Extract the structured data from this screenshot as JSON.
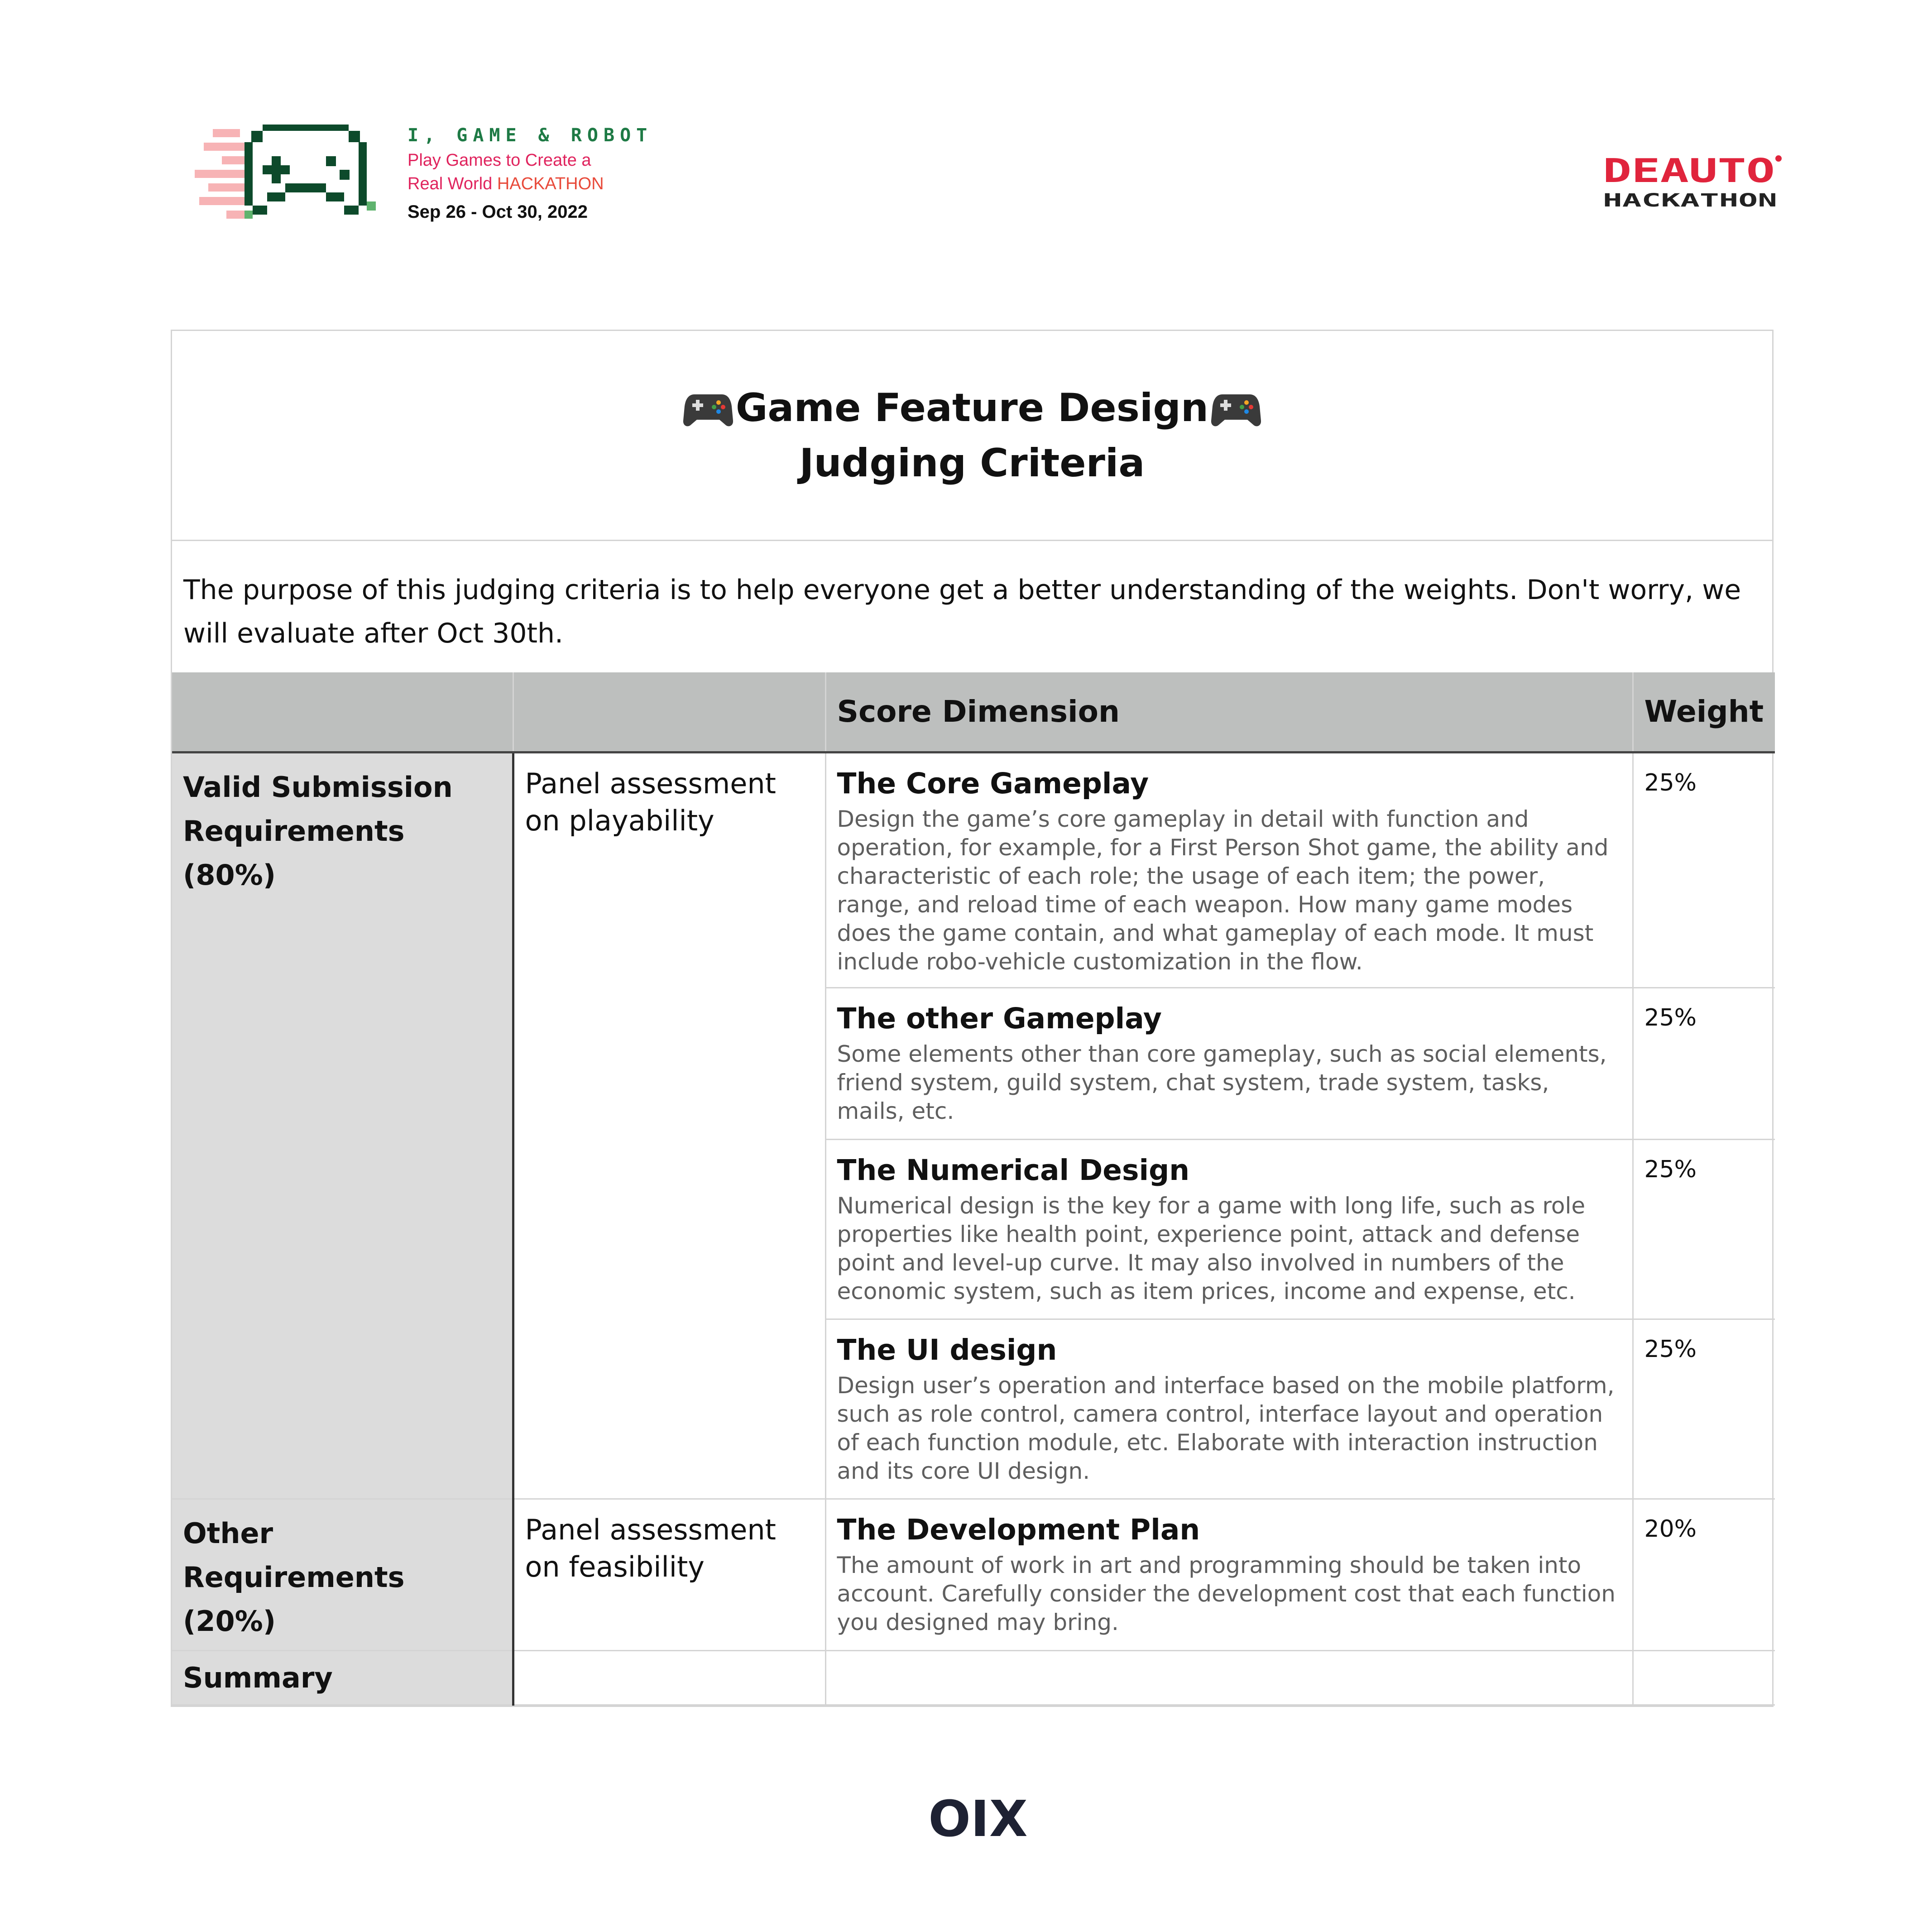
{
  "header": {
    "event_name": "I, GAME & ROBOT",
    "tagline_line1": "Play Games to Create a",
    "tagline_line2_prefix": "Real World ",
    "tagline_line2_highlight": "HACKATHON",
    "dates": "Sep 26 - Oct 30, 2022",
    "partner_logo_line1": "DEAUTO",
    "partner_logo_line2": "HACKATHON",
    "colors": {
      "event_green": "#1e7a45",
      "tagline_pink": "#e0245e",
      "partner_red": "#e0243c"
    }
  },
  "document": {
    "title_line1": "Game Feature Design",
    "title_line2": "Judging Criteria",
    "intro": "The purpose of this judging criteria is to help everyone get a better understanding of the weights. Don't worry, we will evaluate after Oct 30th."
  },
  "table": {
    "headers": [
      "",
      "",
      "Score Dimension",
      "Weight"
    ],
    "sections": [
      {
        "category": "Valid Submission Requirements (80%)",
        "panel": "Panel assessment on playability",
        "rows": [
          {
            "title": "The Core Gameplay",
            "desc": "Design the game’s core gameplay in detail with function and operation, for example, for a First Person Shot game, the ability and characteristic of each role; the usage of each item; the power, range, and reload time of each weapon. How many game modes does the game contain, and what gameplay of each mode. It must include robo-vehicle customization in the flow.",
            "weight": "25%"
          },
          {
            "title": "The other Gameplay",
            "desc": "Some elements other than core gameplay, such as social elements, friend system, guild system, chat system, trade system, tasks, mails, etc.",
            "weight": "25%"
          },
          {
            "title": "The Numerical Design",
            "desc": "Numerical design is the key for a game with long life, such as role properties like health point, experience point, attack and defense point and level-up curve. It may also involved in numbers of the economic system, such as item prices, income and expense, etc.",
            "weight": "25%"
          },
          {
            "title": "The UI design",
            "desc": "Design user’s operation and interface based on the mobile platform, such as role control, camera control, interface layout and operation of each function module, etc. Elaborate with interaction instruction and its core UI design.",
            "weight": "25%"
          }
        ]
      },
      {
        "category": "Other Requirements (20%)",
        "panel": "Panel assessment on feasibility",
        "rows": [
          {
            "title": "The Development Plan",
            "desc": "The amount of work in art and programming should be taken into account. Carefully consider the development cost that each function you designed may bring.",
            "weight": "20%"
          }
        ]
      }
    ],
    "summary_label": "Summary"
  },
  "footer": {
    "logo_text": "OIX"
  },
  "icons": [
    "game-controller-pixel-icon",
    "gamepad-icon",
    "deauto-hackathon-logo",
    "oix-logo"
  ]
}
